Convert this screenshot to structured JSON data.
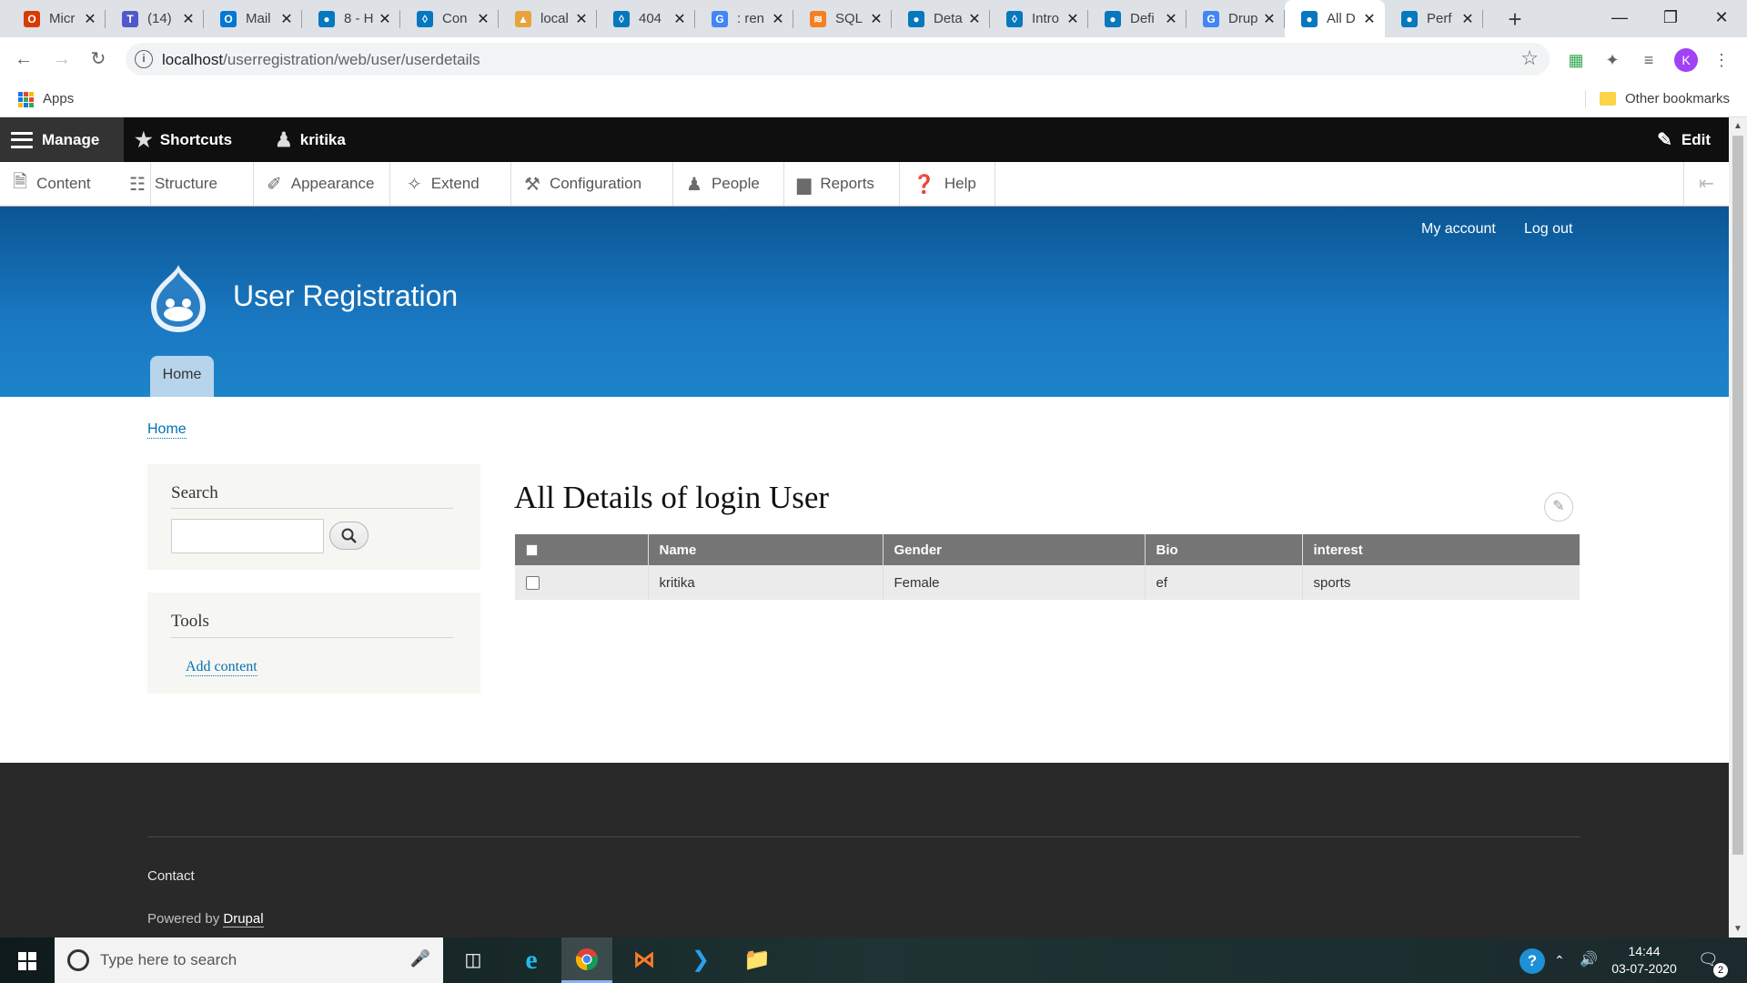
{
  "browser": {
    "tabs": [
      {
        "label": "Micr",
        "color": "#d83b01",
        "glyph": "O"
      },
      {
        "label": "(14)",
        "color": "#5059c9",
        "glyph": "T"
      },
      {
        "label": "Mail",
        "color": "#0078d4",
        "glyph": "O"
      },
      {
        "label": "8 - H",
        "color": "#0678be",
        "glyph": "●"
      },
      {
        "label": "Con",
        "color": "#0678be",
        "glyph": "◊"
      },
      {
        "label": "local",
        "color": "#e8a33d",
        "glyph": "▲"
      },
      {
        "label": "404",
        "color": "#0678be",
        "glyph": "◊"
      },
      {
        "label": ": ren",
        "color": "#4285f4",
        "glyph": "G"
      },
      {
        "label": "SQL",
        "color": "#f48024",
        "glyph": "≋"
      },
      {
        "label": "Deta",
        "color": "#0678be",
        "glyph": "●"
      },
      {
        "label": "Intro",
        "color": "#0678be",
        "glyph": "◊"
      },
      {
        "label": "Defi",
        "color": "#0678be",
        "glyph": "●"
      },
      {
        "label": "Drup",
        "color": "#4285f4",
        "glyph": "G"
      },
      {
        "label": "All D",
        "color": "#0678be",
        "glyph": "●",
        "active": true
      },
      {
        "label": "Perf",
        "color": "#0678be",
        "glyph": "●"
      }
    ],
    "url_host": "localhost",
    "url_path": "/userregistration/web/user/userdetails",
    "bookmarks": {
      "apps": "Apps",
      "other": "Other bookmarks"
    },
    "profile_initial": "K"
  },
  "admin_toolbar": {
    "manage": "Manage",
    "shortcuts": "Shortcuts",
    "user": "kritika",
    "edit": "Edit",
    "tray": [
      "Content",
      "Structure",
      "Appearance",
      "Extend",
      "Configuration",
      "People",
      "Reports",
      "Help"
    ]
  },
  "header": {
    "my_account": "My account",
    "log_out": "Log out",
    "site_name": "User Registration",
    "home_tab": "Home"
  },
  "breadcrumb": "Home",
  "sidebar": {
    "search_title": "Search",
    "tools_title": "Tools",
    "add_content": "Add content"
  },
  "main": {
    "title": "All Details of login User",
    "table": {
      "headers": [
        "Name",
        "Gender",
        "Bio",
        "interest"
      ],
      "rows": [
        {
          "name": "kritika",
          "gender": "Female",
          "bio": "ef",
          "interest": "sports"
        }
      ]
    }
  },
  "footer": {
    "contact": "Contact",
    "powered_by": "Powered by",
    "drupal": "Drupal"
  },
  "taskbar": {
    "search_placeholder": "Type here to search",
    "time": "14:44",
    "date": "03-07-2020",
    "notifications": "2"
  }
}
